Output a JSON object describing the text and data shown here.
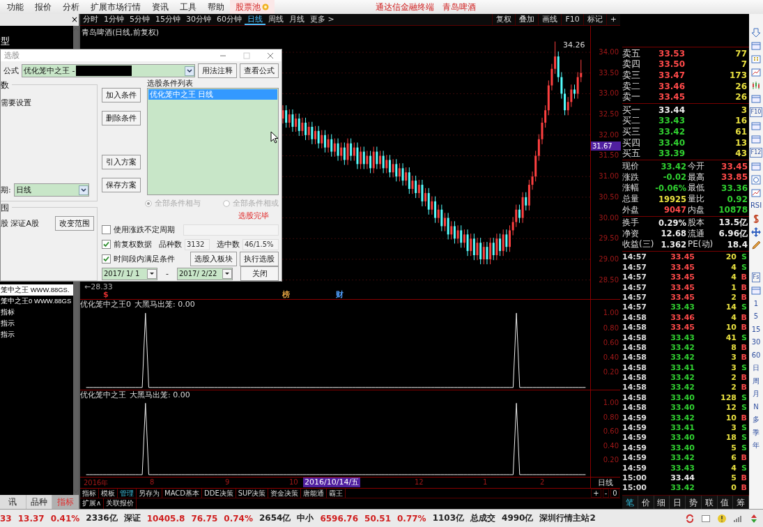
{
  "menu_bar": {
    "items": [
      {
        "label": "功能"
      },
      {
        "label": "报价"
      },
      {
        "label": "分析"
      },
      {
        "label": "扩展市场行情"
      },
      {
        "label": "资讯"
      },
      {
        "label": "工具"
      },
      {
        "label": "帮助"
      }
    ],
    "stock_pool": "股票池",
    "app_title": "通达信金融终端",
    "stock_name": "青岛啤酒"
  },
  "left_panel": {
    "close": "×",
    "top_item": "型",
    "items": [
      {
        "label": "笼中之王 WWW.88GS.",
        "selected": true
      },
      {
        "label": "笼中之王0 WWW.88GS",
        "selected": false
      },
      {
        "label": "指标",
        "selected": false
      },
      {
        "label": "指示",
        "selected": false
      },
      {
        "label": "指示",
        "selected": false
      }
    ],
    "tabs": [
      {
        "label": "讯",
        "selected": false
      },
      {
        "label": "品种",
        "selected": false
      },
      {
        "label": "指标",
        "selected": true
      }
    ]
  },
  "period_toolbar": {
    "periods": [
      {
        "label": "分时",
        "selected": false
      },
      {
        "label": "1分钟",
        "selected": false
      },
      {
        "label": "5分钟",
        "selected": false
      },
      {
        "label": "15分钟",
        "selected": false
      },
      {
        "label": "30分钟",
        "selected": false
      },
      {
        "label": "60分钟",
        "selected": false
      },
      {
        "label": "日线",
        "selected": true
      },
      {
        "label": "周线",
        "selected": false
      },
      {
        "label": "月线",
        "selected": false
      },
      {
        "label": "更多 >",
        "selected": false
      }
    ],
    "tools": [
      "复权",
      "叠加",
      "画线",
      "F10",
      "标记",
      "+"
    ]
  },
  "chart": {
    "title": "青岛啤酒(日线,前复权)",
    "high_label": "34.26",
    "low_label": "←28.33",
    "markers": [
      {
        "label": "$",
        "kind": "dividend"
      },
      {
        "label": "榜",
        "kind": "list"
      },
      {
        "label": "财",
        "kind": "finance"
      }
    ],
    "price_tag": "31.67",
    "chart_data": {
      "type": "candlestick",
      "grid": true,
      "ylim": [
        28.04,
        34.64
      ],
      "yticks": [
        {
          "value": 34,
          "label": "34.00"
        },
        {
          "value": 33.5,
          "label": "33.50"
        },
        {
          "value": 33,
          "label": "33.00"
        },
        {
          "value": 32.5,
          "label": "32.50"
        },
        {
          "value": 32,
          "label": "32.00"
        },
        {
          "value": 31.5,
          "label": "31.50"
        },
        {
          "value": 31,
          "label": "31.00"
        },
        {
          "value": 30.5,
          "label": "30.50"
        },
        {
          "value": 30,
          "label": "30.00"
        },
        {
          "value": 29.5,
          "label": "29.50"
        },
        {
          "value": 29,
          "label": "29.00"
        },
        {
          "value": 28.5,
          "label": "28.50"
        }
      ],
      "categories": [
        null,
        null,
        null,
        null,
        null,
        null,
        null,
        null,
        null,
        null,
        null,
        null,
        null,
        null,
        null,
        null,
        null,
        null,
        null,
        null,
        null,
        null,
        null,
        null,
        null,
        null,
        null,
        null,
        null,
        null,
        null,
        null,
        null,
        null,
        null,
        null,
        null,
        null,
        null,
        null,
        null,
        null,
        null,
        null,
        null,
        null,
        null,
        null,
        null,
        null,
        null,
        null,
        null,
        null,
        null,
        null,
        null,
        null,
        null,
        null,
        null,
        null,
        null,
        null,
        null,
        null,
        null,
        null,
        null,
        null,
        null,
        null,
        null,
        null,
        null,
        null,
        null,
        null,
        null,
        null,
        null,
        null,
        null,
        null,
        null,
        null,
        null,
        null,
        null,
        null,
        null,
        null,
        null
      ],
      "ohlc": [
        [
          32.4,
          32.72,
          32.28,
          32.6
        ],
        [
          32.6,
          32.72,
          32.18,
          32.3
        ],
        [
          32.3,
          32.62,
          32.18,
          32.5
        ],
        [
          32.5,
          32.62,
          32.08,
          32.2
        ],
        [
          32.2,
          32.52,
          32.08,
          32.4
        ],
        [
          32.4,
          32.52,
          31.98,
          32.1
        ],
        [
          32.1,
          32.42,
          31.98,
          32.3
        ],
        [
          32.3,
          32.42,
          31.88,
          32.0
        ],
        [
          32.0,
          32.32,
          31.88,
          32.2
        ],
        [
          32.2,
          32.32,
          31.78,
          31.9
        ],
        [
          31.9,
          32.22,
          31.78,
          32.1
        ],
        [
          32.1,
          32.22,
          31.68,
          31.8
        ],
        [
          31.8,
          32.12,
          31.68,
          32.0
        ],
        [
          32.0,
          32.12,
          31.58,
          31.7
        ],
        [
          31.7,
          32.02,
          31.58,
          31.9
        ],
        [
          31.9,
          32.02,
          31.48,
          31.6
        ],
        [
          31.6,
          31.92,
          31.48,
          31.8
        ],
        [
          31.8,
          31.92,
          31.38,
          31.5
        ],
        [
          31.5,
          31.82,
          31.38,
          31.7
        ],
        [
          31.7,
          31.82,
          31.28,
          31.4
        ],
        [
          31.4,
          31.92,
          31.28,
          31.8
        ],
        [
          31.8,
          31.92,
          31.38,
          31.5
        ],
        [
          31.5,
          31.82,
          31.38,
          31.7
        ],
        [
          31.7,
          31.82,
          31.18,
          31.3
        ],
        [
          31.3,
          31.72,
          31.18,
          31.6
        ],
        [
          31.6,
          31.72,
          31.18,
          31.3
        ],
        [
          31.3,
          31.62,
          31.18,
          31.5
        ],
        [
          31.5,
          31.62,
          31.08,
          31.2
        ],
        [
          31.2,
          31.72,
          31.08,
          31.6
        ],
        [
          31.6,
          31.72,
          31.18,
          31.3
        ],
        [
          31.3,
          31.62,
          31.18,
          31.5
        ],
        [
          31.5,
          31.62,
          31.08,
          31.2
        ],
        [
          31.2,
          31.52,
          31.08,
          31.4
        ],
        [
          31.4,
          31.52,
          30.98,
          31.1
        ],
        [
          31.1,
          31.42,
          30.98,
          31.3
        ],
        [
          31.3,
          31.42,
          30.88,
          31.0
        ],
        [
          31.0,
          31.32,
          30.88,
          31.2
        ],
        [
          31.2,
          31.32,
          30.78,
          30.9
        ],
        [
          30.9,
          31.22,
          30.78,
          31.1
        ],
        [
          31.1,
          31.22,
          30.58,
          30.7
        ],
        [
          30.7,
          31.02,
          30.58,
          30.9
        ],
        [
          30.9,
          31.02,
          30.48,
          30.6
        ],
        [
          30.6,
          30.92,
          30.48,
          30.8
        ],
        [
          30.8,
          30.92,
          30.28,
          30.4
        ],
        [
          30.4,
          30.72,
          30.28,
          30.6
        ],
        [
          30.6,
          30.72,
          30.08,
          30.2
        ],
        [
          30.2,
          30.52,
          30.08,
          30.4
        ],
        [
          30.4,
          30.52,
          29.88,
          30.0
        ],
        [
          30.0,
          30.32,
          29.88,
          30.2
        ],
        [
          30.2,
          30.32,
          29.68,
          29.8
        ],
        [
          29.8,
          30.12,
          29.68,
          30.0
        ],
        [
          30.0,
          30.12,
          29.48,
          29.6
        ],
        [
          29.6,
          29.92,
          29.48,
          29.8
        ],
        [
          29.8,
          29.92,
          29.38,
          29.5
        ],
        [
          29.5,
          29.82,
          29.38,
          29.7
        ],
        [
          29.7,
          29.82,
          29.28,
          29.4
        ],
        [
          29.4,
          29.72,
          29.28,
          29.6
        ],
        [
          29.6,
          29.72,
          29.08,
          29.2
        ],
        [
          29.2,
          29.62,
          29.08,
          29.5
        ],
        [
          29.5,
          29.62,
          28.98,
          29.1
        ],
        [
          29.1,
          29.52,
          28.98,
          29.4
        ],
        [
          29.4,
          29.52,
          28.88,
          29.0
        ],
        [
          29.0,
          29.42,
          28.88,
          29.3
        ],
        [
          29.3,
          29.42,
          28.88,
          29.0
        ],
        [
          29.0,
          29.52,
          28.88,
          29.4
        ],
        [
          29.4,
          29.52,
          28.98,
          29.1
        ],
        [
          29.1,
          29.62,
          28.98,
          29.5
        ],
        [
          29.5,
          29.62,
          29.08,
          29.2
        ],
        [
          29.2,
          29.72,
          29.08,
          29.6
        ],
        [
          29.6,
          29.72,
          29.18,
          29.3
        ],
        [
          29.3,
          29.82,
          29.18,
          29.7
        ],
        [
          29.7,
          30.02,
          29.58,
          29.9
        ],
        [
          29.9,
          30.32,
          29.78,
          30.2
        ],
        [
          30.2,
          30.32,
          29.88,
          30.0
        ],
        [
          30.0,
          30.62,
          29.88,
          30.5
        ],
        [
          30.5,
          30.62,
          30.18,
          30.3
        ],
        [
          30.3,
          30.92,
          30.18,
          30.8
        ],
        [
          30.8,
          31.12,
          30.68,
          31.0
        ],
        [
          31.0,
          31.62,
          30.88,
          31.5
        ],
        [
          31.5,
          32.02,
          31.38,
          31.9
        ],
        [
          31.9,
          32.42,
          31.78,
          32.3
        ],
        [
          32.3,
          32.72,
          32.18,
          32.6
        ],
        [
          32.6,
          33.32,
          32.48,
          33.2
        ],
        [
          33.2,
          33.72,
          33.08,
          33.6
        ],
        [
          33.6,
          34.26,
          33.48,
          33.9
        ],
        [
          33.9,
          34.02,
          33.28,
          33.4
        ],
        [
          33.4,
          33.52,
          32.88,
          33.0
        ],
        [
          33.0,
          33.12,
          32.48,
          32.6
        ],
        [
          32.6,
          32.92,
          32.48,
          32.8
        ],
        [
          32.8,
          33.22,
          32.68,
          33.1
        ],
        [
          33.1,
          33.22,
          32.88,
          33.0
        ],
        [
          33.0,
          33.52,
          32.88,
          33.4
        ],
        [
          33.4,
          33.82,
          33.28,
          33.5
        ]
      ]
    },
    "x_labels": [
      {
        "label": "2016年",
        "kind": "tick"
      },
      {
        "label": "8",
        "kind": "tick"
      },
      {
        "label": "9",
        "kind": "tick"
      },
      {
        "label": "10",
        "kind": "tick"
      },
      {
        "label": "2016/10/14/五",
        "kind": "cursor"
      },
      {
        "label": "12",
        "kind": "tick"
      },
      {
        "label": "1",
        "kind": "tick"
      },
      {
        "label": "2",
        "kind": "tick"
      }
    ]
  },
  "indicators": [
    {
      "name": "优化笼中之王0",
      "reading": ": 0.00",
      "chart_data": {
        "type": "line",
        "ylim": [
          -0.03,
          1.18
        ],
        "yticks": [
          {
            "value": 1,
            "label": "1.00"
          },
          {
            "value": 0.8,
            "label": "0.80"
          },
          {
            "value": 0.6,
            "label": "0.60"
          },
          {
            "value": 0.4,
            "label": "0.40"
          },
          {
            "value": 0.2,
            "label": "0.20"
          }
        ],
        "series": [
          {
            "name": "大黑马出笼",
            "color": "#eeeeee",
            "values": [
              0,
              0,
              0,
              0,
              0,
              0,
              0,
              0,
              0,
              0,
              0,
              0,
              0,
              0,
              0,
              0,
              0,
              0,
              1,
              0,
              0,
              0,
              0,
              0,
              0,
              0,
              0,
              0,
              0,
              0,
              0,
              0,
              0,
              0,
              0,
              0,
              0,
              0,
              0,
              0,
              0,
              0,
              0,
              0,
              0,
              0,
              0,
              0,
              0,
              0,
              0,
              0,
              0,
              0,
              0,
              0,
              0,
              0,
              0,
              0,
              0,
              0,
              0,
              0,
              0,
              0,
              0,
              0,
              0,
              0,
              0,
              0,
              0,
              0,
              0,
              0,
              0,
              0,
              0,
              0,
              0,
              0,
              0,
              0,
              0,
              0,
              0,
              0,
              0,
              0,
              0,
              0,
              0,
              0,
              0,
              0,
              0,
              0,
              0,
              0,
              0,
              0,
              0,
              0,
              0,
              0,
              0,
              0,
              0,
              0,
              0,
              0,
              0,
              0,
              0,
              0,
              0,
              0,
              0,
              0,
              0,
              0,
              0,
              0,
              0,
              0,
              0,
              0,
              0,
              0,
              0,
              1,
              0,
              0,
              0,
              0,
              0,
              0,
              0,
              0,
              0,
              0,
              0,
              0,
              0,
              0,
              0,
              0,
              0,
              0,
              0,
              0,
              0
            ]
          }
        ]
      }
    },
    {
      "name": "优化笼中之王",
      "reading": ": 0.00",
      "chart_data": {
        "type": "line",
        "ylim": [
          -0.03,
          1.18
        ],
        "yticks": [
          {
            "value": 1,
            "label": "1.00"
          },
          {
            "value": 0.8,
            "label": "0.80"
          },
          {
            "value": 0.6,
            "label": "0.60"
          },
          {
            "value": 0.4,
            "label": "0.40"
          },
          {
            "value": 0.2,
            "label": "0.20"
          }
        ],
        "series": [
          {
            "name": "大黑马出笼",
            "color": "#eeeeee",
            "values": [
              0,
              0,
              0,
              0,
              0,
              0,
              0,
              0,
              0,
              0,
              0,
              0,
              0,
              0,
              0,
              0,
              0,
              0,
              1,
              0,
              0,
              0,
              0,
              0,
              0,
              0,
              0,
              0,
              0,
              0,
              0,
              0,
              0,
              0,
              0,
              0,
              0,
              0,
              0,
              0,
              0,
              0,
              0,
              0,
              0,
              0,
              0,
              0,
              0,
              0,
              0,
              0,
              0,
              0,
              0,
              0,
              0,
              0,
              0,
              0,
              0,
              0,
              0,
              0,
              0,
              0,
              0,
              0,
              0,
              0,
              0,
              0,
              0,
              0,
              0,
              0,
              0,
              0,
              0,
              0,
              0,
              0,
              0,
              0,
              0,
              0,
              0,
              0,
              0,
              0,
              0,
              0,
              0,
              0,
              0,
              0,
              0,
              0,
              0,
              0,
              0,
              0,
              0,
              0,
              0,
              0,
              0,
              0,
              0,
              0,
              0,
              0,
              0,
              0,
              0,
              0,
              0,
              0,
              0,
              0,
              0,
              0,
              0,
              0,
              0,
              0,
              0,
              0,
              0,
              0,
              0,
              1,
              0,
              0,
              0,
              0,
              0,
              0,
              0,
              0,
              0,
              0,
              0,
              0,
              0,
              0,
              0,
              0,
              0,
              0,
              0,
              0,
              0
            ]
          }
        ]
      }
    }
  ],
  "bottom_tabs": [
    {
      "label": "指标",
      "selected": false
    },
    {
      "label": "模板",
      "selected": false
    },
    {
      "label": "管理",
      "selected": true
    },
    {
      "label": "另存为",
      "selected": false
    },
    {
      "label": "MACD基本",
      "selected": false
    },
    {
      "label": "DDE决策",
      "selected": false
    },
    {
      "label": "SUP决策",
      "selected": false
    },
    {
      "label": "资金决策",
      "selected": false
    },
    {
      "label": "唐能通",
      "selected": false
    },
    {
      "label": "霸王",
      "selected": false
    }
  ],
  "bottom_tabs_2": [
    "扩展∧",
    "关联报价"
  ],
  "period_label": "日线",
  "zoom_controls": [
    "+",
    "-",
    "0"
  ],
  "quote": {
    "sell": [
      {
        "label": "卖五",
        "price": "33.53",
        "color": "#ff4a4a",
        "volume": "77"
      },
      {
        "label": "卖四",
        "price": "33.50",
        "color": "#ff4a4a",
        "volume": "7"
      },
      {
        "label": "卖三",
        "price": "33.47",
        "color": "#ff4a4a",
        "volume": "173"
      },
      {
        "label": "卖二",
        "price": "33.46",
        "color": "#ff4a4a",
        "volume": "26"
      },
      {
        "label": "卖一",
        "price": "33.45",
        "color": "#ff4a4a",
        "volume": "26"
      }
    ],
    "buy": [
      {
        "label": "买一",
        "price": "33.44",
        "color": "#eeeeee",
        "volume": "3"
      },
      {
        "label": "买二",
        "price": "33.43",
        "color": "#30d030",
        "volume": "16"
      },
      {
        "label": "买三",
        "price": "33.42",
        "color": "#30d030",
        "volume": "61"
      },
      {
        "label": "买四",
        "price": "33.40",
        "color": "#30d030",
        "volume": "13"
      },
      {
        "label": "买五",
        "price": "33.39",
        "color": "#30d030",
        "volume": "43"
      }
    ],
    "stats": [
      {
        "cells": [
          {
            "label": "现价",
            "value": "33.42",
            "color": "#30d030"
          },
          {
            "label": "今开",
            "value": "33.45",
            "color": "#ff4a4a"
          }
        ]
      },
      {
        "cells": [
          {
            "label": "涨跌",
            "value": "-0.02",
            "color": "#30d030"
          },
          {
            "label": "最高",
            "value": "33.85",
            "color": "#ff4a4a"
          }
        ]
      },
      {
        "cells": [
          {
            "label": "涨幅",
            "value": "-0.06%",
            "color": "#30d030"
          },
          {
            "label": "最低",
            "value": "33.36",
            "color": "#30d030"
          }
        ]
      },
      {
        "cells": [
          {
            "label": "总量",
            "value": "19925",
            "color": "#e8e040"
          },
          {
            "label": "量比",
            "value": "0.92",
            "color": "#30d030"
          }
        ]
      },
      {
        "cells": [
          {
            "label": "外盘",
            "value": "9047",
            "color": "#ff4a4a"
          },
          {
            "label": "内盘",
            "value": "10878",
            "color": "#30d030"
          }
        ]
      }
    ],
    "finance": [
      {
        "cells": [
          {
            "label": "换手",
            "value": "0.29%"
          },
          {
            "label": "股本",
            "value": "13.5亿"
          }
        ]
      },
      {
        "cells": [
          {
            "label": "净资",
            "value": "12.68"
          },
          {
            "label": "流通",
            "value": "6.96亿"
          }
        ]
      },
      {
        "cells": [
          {
            "label": "收益(三)",
            "value": "1.362"
          },
          {
            "label": "PE(动)",
            "value": "18.4"
          }
        ]
      }
    ],
    "trades": [
      {
        "time": "14:57",
        "price": "33.45",
        "color": "#ff4a4a",
        "volume": "20",
        "side": {
          "label": "S",
          "color": "#30d030"
        }
      },
      {
        "time": "14:57",
        "price": "33.45",
        "color": "#ff4a4a",
        "volume": "4",
        "side": {
          "label": "S",
          "color": "#30d030"
        }
      },
      {
        "time": "14:57",
        "price": "33.45",
        "color": "#ff4a4a",
        "volume": "4",
        "side": {
          "label": "B",
          "color": "#ff4a4a"
        }
      },
      {
        "time": "14:57",
        "price": "33.45",
        "color": "#ff4a4a",
        "volume": "1",
        "side": {
          "label": "B",
          "color": "#ff4a4a"
        }
      },
      {
        "time": "14:57",
        "price": "33.45",
        "color": "#ff4a4a",
        "volume": "2",
        "side": {
          "label": "B",
          "color": "#ff4a4a"
        }
      },
      {
        "time": "14:57",
        "price": "33.43",
        "color": "#30d030",
        "volume": "14",
        "side": {
          "label": "S",
          "color": "#30d030"
        }
      },
      {
        "time": "14:58",
        "price": "33.46",
        "color": "#ff4a4a",
        "volume": "4",
        "side": {
          "label": "B",
          "color": "#ff4a4a"
        }
      },
      {
        "time": "14:58",
        "price": "33.45",
        "color": "#ff4a4a",
        "volume": "10",
        "side": {
          "label": "B",
          "color": "#ff4a4a"
        }
      },
      {
        "time": "14:58",
        "price": "33.43",
        "color": "#30d030",
        "volume": "41",
        "side": {
          "label": "S",
          "color": "#30d030"
        }
      },
      {
        "time": "14:58",
        "price": "33.42",
        "color": "#30d030",
        "volume": "8",
        "side": {
          "label": "B",
          "color": "#ff4a4a"
        }
      },
      {
        "time": "14:58",
        "price": "33.42",
        "color": "#30d030",
        "volume": "3",
        "side": {
          "label": "B",
          "color": "#ff4a4a"
        }
      },
      {
        "time": "14:58",
        "price": "33.41",
        "color": "#30d030",
        "volume": "3",
        "side": {
          "label": "S",
          "color": "#30d030"
        }
      },
      {
        "time": "14:58",
        "price": "33.42",
        "color": "#30d030",
        "volume": "2",
        "side": {
          "label": "B",
          "color": "#ff4a4a"
        }
      },
      {
        "time": "14:58",
        "price": "33.42",
        "color": "#30d030",
        "volume": "2",
        "side": {
          "label": "B",
          "color": "#ff4a4a"
        }
      },
      {
        "time": "14:58",
        "price": "33.40",
        "color": "#30d030",
        "volume": "128",
        "side": {
          "label": "S",
          "color": "#30d030"
        }
      },
      {
        "time": "14:58",
        "price": "33.40",
        "color": "#30d030",
        "volume": "12",
        "side": {
          "label": "S",
          "color": "#30d030"
        }
      },
      {
        "time": "14:59",
        "price": "33.42",
        "color": "#30d030",
        "volume": "10",
        "side": {
          "label": "B",
          "color": "#ff4a4a"
        }
      },
      {
        "time": "14:59",
        "price": "33.41",
        "color": "#30d030",
        "volume": "3",
        "side": {
          "label": "S",
          "color": "#30d030"
        }
      },
      {
        "time": "14:59",
        "price": "33.40",
        "color": "#30d030",
        "volume": "18",
        "side": {
          "label": "S",
          "color": "#30d030"
        }
      },
      {
        "time": "14:59",
        "price": "33.40",
        "color": "#30d030",
        "volume": "5",
        "side": {
          "label": "S",
          "color": "#30d030"
        }
      },
      {
        "time": "14:59",
        "price": "33.42",
        "color": "#30d030",
        "volume": "6",
        "side": {
          "label": "B",
          "color": "#ff4a4a"
        }
      },
      {
        "time": "14:59",
        "price": "33.43",
        "color": "#30d030",
        "volume": "4",
        "side": {
          "label": "S",
          "color": "#30d030"
        }
      },
      {
        "time": "15:00",
        "price": "33.44",
        "color": "#eeeeee",
        "volume": "5",
        "side": {
          "label": "B",
          "color": "#ff4a4a"
        }
      },
      {
        "time": "15:00",
        "price": "33.42",
        "color": "#30d030",
        "volume": "0",
        "side": {
          "label": "B",
          "color": "#ff4a4a"
        }
      }
    ],
    "tabs": [
      {
        "label": "笔",
        "selected": true
      },
      {
        "label": "价",
        "selected": false
      },
      {
        "label": "细",
        "selected": false
      },
      {
        "label": "日",
        "selected": false
      },
      {
        "label": "势",
        "selected": false
      },
      {
        "label": "联",
        "selected": false
      },
      {
        "label": "值",
        "selected": false
      },
      {
        "label": "筹",
        "selected": false
      }
    ]
  },
  "tool_strip": [
    {
      "kind": "arrow"
    },
    {
      "kind": "icon"
    },
    {
      "kind": "grid"
    },
    {
      "kind": "line"
    },
    {
      "kind": "candle"
    },
    {
      "kind": "icon"
    },
    {
      "kind": "boxed",
      "label": "F10"
    },
    {
      "kind": "icon"
    },
    {
      "kind": "icon"
    },
    {
      "kind": "boxed",
      "label": "F12"
    },
    {
      "kind": "icon"
    },
    {
      "kind": "circle"
    },
    {
      "kind": "line"
    },
    {
      "kind": "text",
      "label": "RSI"
    },
    {
      "kind": "dollar"
    },
    {
      "kind": "move"
    },
    {
      "kind": "pencil"
    },
    {
      "kind": "gap"
    },
    {
      "kind": "boxed",
      "label": "Fs"
    },
    {
      "kind": "icon"
    },
    {
      "kind": "text",
      "label": "1"
    },
    {
      "kind": "text",
      "label": "5"
    },
    {
      "kind": "text",
      "label": "15"
    },
    {
      "kind": "text",
      "label": "30"
    },
    {
      "kind": "text",
      "label": "60"
    },
    {
      "kind": "text",
      "label": "日"
    },
    {
      "kind": "text",
      "label": "周"
    },
    {
      "kind": "text",
      "label": "月"
    },
    {
      "kind": "text",
      "label": "N"
    },
    {
      "kind": "text",
      "label": "多"
    },
    {
      "kind": "text",
      "label": "季"
    },
    {
      "kind": "text",
      "label": "年"
    }
  ],
  "dialog": {
    "title": "选股",
    "formula_label": "公式",
    "formula": "优化笼中之王 -",
    "buttons_top": [
      "用法注释",
      "查看公式"
    ],
    "params_group": "数",
    "params_note": "需要设置",
    "period_label": "期:",
    "period": "日线",
    "range_group": "围",
    "range": "股 深证A股",
    "range_button": "改变范围",
    "side_buttons": [
      "加入条件",
      "删除条件",
      "引入方案",
      "保存方案"
    ],
    "list_label": "选股条件列表",
    "conditions": [
      {
        "label": "优化笼中之王  日线",
        "selected": true
      }
    ],
    "radios": [
      {
        "label": "全部条件相与",
        "selected": true,
        "disabled": true
      },
      {
        "label": "全部条件相或",
        "selected": false,
        "disabled": true
      }
    ],
    "status": "选股完毕",
    "check_variable": {
      "label": "使用涨跌不定周期",
      "checked": false
    },
    "check_adjusted": {
      "label": "前复权数据",
      "checked": true
    },
    "count_label": "品种数",
    "count": "3132",
    "selected_label": "选中数",
    "selected_count": "46/1.5%",
    "check_period": {
      "label": "时间段内满足条件",
      "checked": true
    },
    "to_block": "选股入板块",
    "run": "执行选股",
    "date_from": "2017/ 1/ 1",
    "date_sep": "-",
    "date_to": "2017/ 2/22",
    "close": "关闭"
  },
  "status_bar": [
    {
      "label": "33",
      "color": "#d02020"
    },
    {
      "label": "13.37",
      "color": "#d02020"
    },
    {
      "label": "0.41%",
      "color": "#d02020"
    },
    {
      "label": "2336亿",
      "color": "#222222"
    },
    {
      "label": "深证",
      "color": "#222222"
    },
    {
      "label": "10405.8",
      "color": "#d02020"
    },
    {
      "label": "76.75",
      "color": "#d02020"
    },
    {
      "label": "0.74%",
      "color": "#d02020"
    },
    {
      "label": "2654亿",
      "color": "#222222"
    },
    {
      "label": "中小",
      "color": "#222222"
    },
    {
      "label": "6596.76",
      "color": "#d02020"
    },
    {
      "label": "50.51",
      "color": "#d02020"
    },
    {
      "label": "0.77%",
      "color": "#d02020"
    },
    {
      "label": "1103亿",
      "color": "#222222"
    },
    {
      "label": "总成交",
      "color": "#222222"
    },
    {
      "label": "4990亿",
      "color": "#222222"
    },
    {
      "label": "深圳行情主站2",
      "color": "#222222"
    }
  ]
}
